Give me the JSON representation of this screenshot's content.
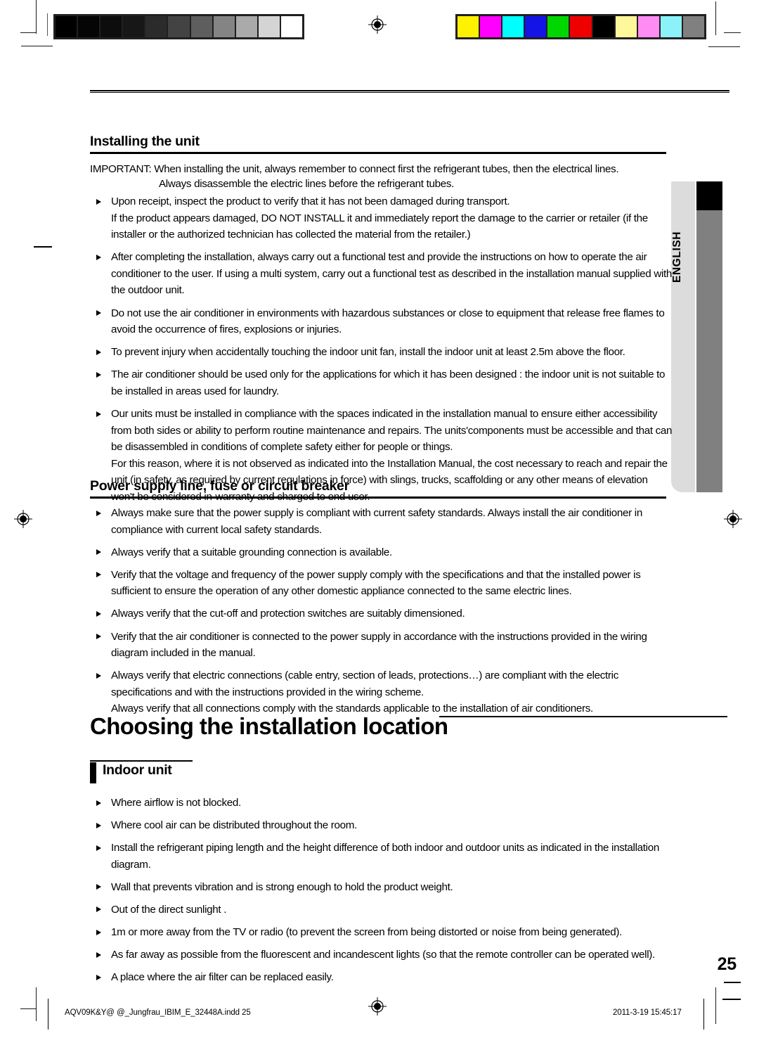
{
  "document": {
    "page_number": "25",
    "language_tab": "ENGLISH"
  },
  "sections": [
    {
      "heading": "Installing the unit",
      "important_label": "IMPORTANT:",
      "important_line1": "IMPORTANT: When installing the unit, always remember to connect first the refrigerant tubes, then the electrical lines.",
      "important_line2": "Always disassemble the electric lines before the refrigerant tubes.",
      "bullets": [
        "Upon receipt, inspect the product to verify that it has not been damaged during transport.\nIf the product appears damaged, DO NOT INSTALL it and immediately report the damage to the carrier or retailer (if the installer or the authorized technician has collected the material from the retailer.)",
        "After completing the installation, always carry out a functional test and provide the instructions on how to operate the air conditioner to the user.  If using a multi system, carry out a functional test as described in the installation manual supplied with the outdoor unit.",
        "Do not use the air conditioner in environments with hazardous substances or close to equipment that release free flames to avoid the occurrence of fires, explosions or injuries.",
        "To prevent injury when accidentally touching the indoor unit fan, install the indoor unit at least 2.5m above the floor.",
        "The air conditioner should be used only for the applications for which it has been designed : the indoor unit is not suitable to be installed in areas used for laundry.",
        "Our units must be installed in compliance with the spaces indicated in the installation manual to ensure either accessibility from both sides or ability to perform routine maintenance and repairs. The units'components must be accessible and that can be disassembled in conditions of complete safety either for people or things.\nFor this reason, where it is not observed as indicated into the Installation Manual, the cost necessary to reach and repair the unit (in safety, as required by current regulations in force) with slings, trucks, scaffolding or any other means of elevation won't be considered in-warranty and charged to end user."
      ]
    },
    {
      "heading": "Power supply line, fuse or circuit breaker",
      "bullets": [
        "Always make sure that the power supply is compliant with current safety standards. Always install the air conditioner in compliance with current local safety standards.",
        "Always verify that a suitable grounding connection is available.",
        "Verify that the voltage and frequency of the power supply comply with the specifications and that the installed power is sufficient to ensure the operation of any other domestic appliance connected to the same electric lines.",
        "Always verify that the cut-off and protection switches are suitably dimensioned.",
        "Verify that the air conditioner is connected to the power supply in accordance with the instructions provided in the wiring diagram included in the manual.",
        "Always verify that electric connections (cable entry, section of leads, protections…) are compliant with the electric specifications and with the instructions provided in the wiring scheme.\nAlways verify that all connections comply with the standards applicable to the installation of air conditioners."
      ]
    }
  ],
  "chapter": {
    "title": "Choosing the installation location",
    "subsection": {
      "heading": "Indoor unit",
      "bullets": [
        "Where airflow is not blocked.",
        "Where cool air can be distributed throughout the room.",
        "Install the refrigerant piping length and the height difference of both indoor and outdoor units as indicated in the installation diagram.",
        "Wall that prevents vibration and is strong enough to hold the product weight.",
        "Out of the direct sunlight .",
        "1m or more away from the TV or radio (to prevent the screen from being distorted or noise from being generated).",
        "As far away as possible from the fluorescent and incandescent lights (so that the remote controller can be operated well).",
        "A place where the air filter can be replaced easily."
      ]
    }
  },
  "footer": {
    "filename": "AQV09K&Y@ @_Jungfrau_IBIM_E_32448A.indd   25",
    "timestamp": "2011-3-19   15:45:17"
  },
  "calibration": {
    "grayscale_patches": [
      "#000000",
      "#050505",
      "#0d0d0d",
      "#171717",
      "#2b2b2b",
      "#434343",
      "#5e5e5e",
      "#848484",
      "#aaaaaa",
      "#d4d4d4",
      "#ffffff"
    ],
    "color_patches": [
      "#fff200",
      "#ff00ff",
      "#00ffff",
      "#1414e6",
      "#00d700",
      "#ee0000",
      "#000000",
      "#fff89a",
      "#ff8cf5",
      "#8cf2f9",
      "#808080"
    ]
  }
}
